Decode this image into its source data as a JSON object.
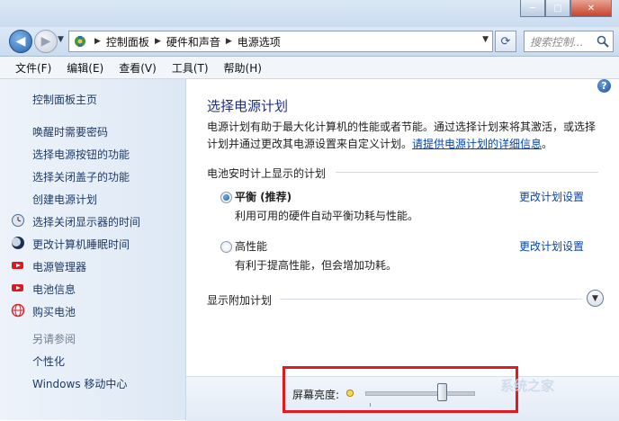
{
  "window": {
    "controls": {
      "minimize": "─",
      "maximize": "□",
      "close": "✕"
    }
  },
  "nav": {
    "breadcrumbs": [
      "控制面板",
      "硬件和声音",
      "电源选项"
    ],
    "search_placeholder": "搜索控制..."
  },
  "menu": [
    "文件(F)",
    "编辑(E)",
    "查看(V)",
    "工具(T)",
    "帮助(H)"
  ],
  "sidebar": {
    "home": "控制面板主页",
    "links": [
      "唤醒时需要密码",
      "选择电源按钮的功能",
      "选择关闭盖子的功能",
      "创建电源计划"
    ],
    "icon_links": [
      {
        "label": "选择关闭显示器的时间",
        "icon": "display-clock-icon"
      },
      {
        "label": "更改计算机睡眠时间",
        "icon": "moon-icon"
      },
      {
        "label": "电源管理器",
        "icon": "battery-red-icon"
      },
      {
        "label": "电池信息",
        "icon": "battery-red-icon"
      },
      {
        "label": "购买电池",
        "icon": "globe-icon"
      }
    ],
    "see_also": "另请参阅",
    "see_also_links": [
      "个性化",
      "Windows 移动中心"
    ]
  },
  "main": {
    "title": "选择电源计划",
    "description": "电源计划有助于最大化计算机的性能或者节能。通过选择计划来将其激活，或选择计划并通过更改其电源设置来自定义计划。",
    "description_link": "请提供电源计划的详细信息",
    "description_end": "。",
    "group_heading": "电池安时计上显示的计划",
    "plans": [
      {
        "name": "平衡 (推荐)",
        "desc": "利用可用的硬件自动平衡功耗与性能。",
        "link": "更改计划设置",
        "selected": true
      },
      {
        "name": "高性能",
        "desc": "有利于提高性能，但会增加功耗。",
        "link": "更改计划设置",
        "selected": false
      }
    ],
    "additional": "显示附加计划"
  },
  "bottom": {
    "brightness_label": "屏幕亮度:",
    "brightness_level": 0.7,
    "watermark": "系统之家"
  },
  "colors": {
    "highlight": "#e2191f",
    "link": "#0645ad",
    "title": "#1e3287"
  }
}
